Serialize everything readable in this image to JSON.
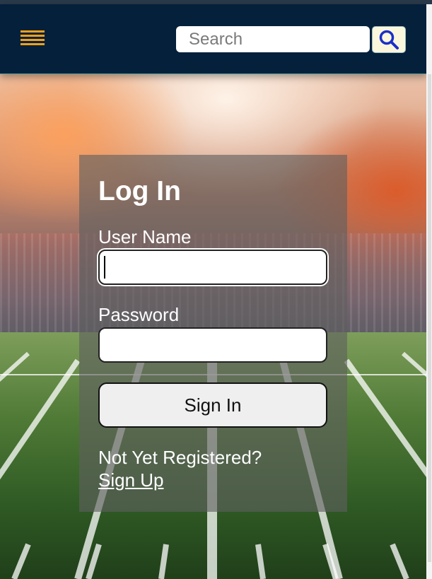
{
  "header": {
    "menu_icon": "hamburger-menu-icon",
    "search": {
      "placeholder": "Search",
      "value": ""
    },
    "search_icon": "search-icon",
    "colors": {
      "background": "#05203b",
      "accent": "#f0a11a",
      "search_button": "#fbf7dd",
      "search_icon": "#1b2fc9"
    }
  },
  "background": {
    "description_icon": "stadium-field-background"
  },
  "login": {
    "title": "Log In",
    "username_label": "User Name",
    "username_value": "",
    "password_label": "Password",
    "password_value": "",
    "signin_label": "Sign In",
    "not_registered": "Not Yet Registered?",
    "signup_label": "Sign Up"
  }
}
